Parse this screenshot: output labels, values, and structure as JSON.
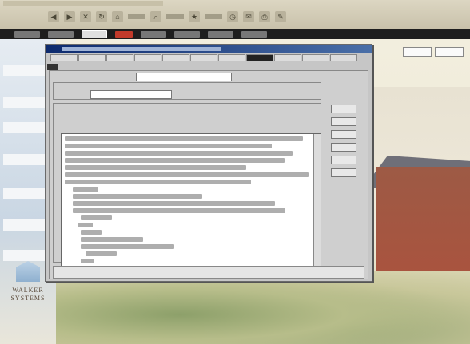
{
  "browser": {
    "title": "",
    "toolbar_labels": [
      "",
      "",
      "",
      "",
      ""
    ]
  },
  "app_menu": {
    "items": [
      "",
      "",
      "",
      "",
      "",
      "",
      "",
      ""
    ]
  },
  "site": {
    "nav": [
      "",
      "",
      "",
      "",
      "",
      "",
      ""
    ],
    "logo_title": "WALKER SYSTEMS",
    "logo_subtitle": "",
    "top_right_buttons": [
      "",
      ""
    ]
  },
  "dialog": {
    "title": "",
    "tabs": [
      "",
      "",
      "",
      "",
      "",
      "",
      "",
      "",
      "",
      "",
      "",
      "",
      ""
    ],
    "name_label": "",
    "name_value": "",
    "configuration_group": "",
    "config_value": "",
    "properties_group": "",
    "code_lines": [
      "",
      "",
      "",
      "",
      "",
      "",
      "",
      "",
      "",
      "",
      "",
      "",
      "",
      "",
      "",
      "",
      "",
      "",
      "",
      ""
    ],
    "side_panel_title": "",
    "side_buttons": [
      "",
      "",
      "",
      "",
      "",
      ""
    ],
    "status_group": "",
    "status_text": ""
  },
  "colors": {
    "menubar": "#1e1e1e",
    "title_bar": "#0d2a6e",
    "accent_red": "#c23a2a"
  }
}
